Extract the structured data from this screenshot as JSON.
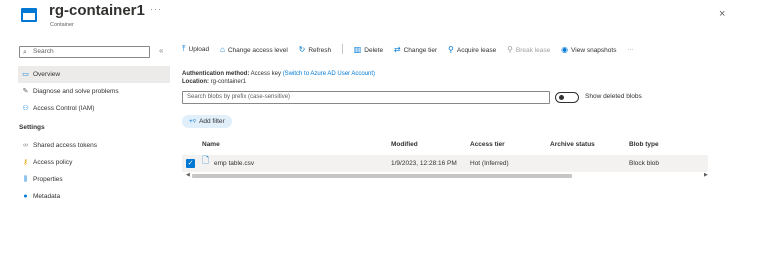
{
  "header": {
    "title": "rg-container1",
    "subtitle": "Container",
    "more": "···",
    "close": "×"
  },
  "sidebar": {
    "search_placeholder": "Search",
    "collapse": "«",
    "items": [
      {
        "label": "Overview",
        "icon": "overview-icon"
      },
      {
        "label": "Diagnose and solve problems",
        "icon": "wrench-icon"
      },
      {
        "label": "Access Control (IAM)",
        "icon": "iam-icon"
      }
    ],
    "section": "Settings",
    "settings_items": [
      {
        "label": "Shared access tokens",
        "icon": "link-icon"
      },
      {
        "label": "Access policy",
        "icon": "key-icon"
      },
      {
        "label": "Properties",
        "icon": "properties-icon"
      },
      {
        "label": "Metadata",
        "icon": "info-icon"
      }
    ]
  },
  "toolbar": {
    "upload": "Upload",
    "change_access_level": "Change access level",
    "refresh": "Refresh",
    "delete": "Delete",
    "change_tier": "Change tier",
    "acquire_lease": "Acquire lease",
    "break_lease": "Break lease",
    "view_snapshots": "View snapshots",
    "more": "···"
  },
  "auth": {
    "method_label": "Authentication method:",
    "method_value": "Access key",
    "switch_link": "(Switch to Azure AD User Account)",
    "location_label": "Location:",
    "location_value": "rg-container1"
  },
  "filter": {
    "prefix_placeholder": "Search blobs by prefix (case-sensitive)",
    "show_deleted": "Show deleted blobs",
    "add_filter": "Add filter"
  },
  "table": {
    "headers": {
      "name": "Name",
      "modified": "Modified",
      "access_tier": "Access tier",
      "archive_status": "Archive status",
      "blob_type": "Blob type"
    },
    "rows": [
      {
        "name": "emp table.csv",
        "modified": "1/9/2023, 12:28:16 PM",
        "access_tier": "Hot (Inferred)",
        "archive_status": "",
        "blob_type": "Block blob"
      }
    ]
  },
  "colors": {
    "accent": "#0078d4",
    "selected_row": "#f3f2f1",
    "nav_active": "#edebe9"
  }
}
